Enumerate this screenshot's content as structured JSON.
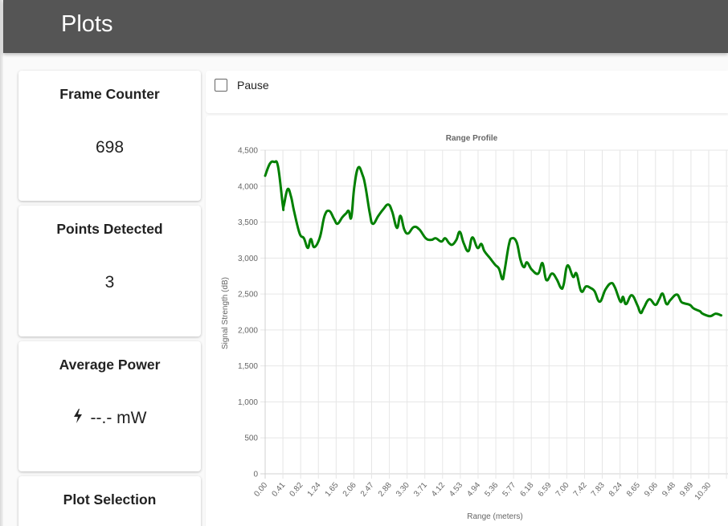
{
  "appbar": {
    "title": "Plots"
  },
  "cards": [
    {
      "title": "Frame Counter",
      "value": "698"
    },
    {
      "title": "Points Detected",
      "value": "3"
    },
    {
      "title": "Average Power",
      "value": "--.- mW",
      "icon": "bolt-icon"
    },
    {
      "title": "Plot Selection"
    }
  ],
  "controls": {
    "pause_label": "Pause",
    "pause_checked": false
  },
  "colors": {
    "appbar": "#555555",
    "line": "#008000",
    "grid": "#e5e5e5"
  },
  "chart_data": {
    "type": "line",
    "title": "Range Profile",
    "xlabel": "Range (meters)",
    "ylabel": "Signal Strength (dB)",
    "ylim": [
      0,
      4500
    ],
    "yticks": [
      0,
      500,
      1000,
      1500,
      2000,
      2500,
      3000,
      3500,
      4000,
      4500
    ],
    "ytick_labels": [
      "0",
      "500",
      "1,000",
      "1,500",
      "2,000",
      "2,500",
      "3,000",
      "3,500",
      "4,000",
      "4,500"
    ],
    "xtick_labels": [
      "0.00",
      "0.41",
      "0.82",
      "1.24",
      "1.65",
      "2.06",
      "2.47",
      "2.88",
      "3.30",
      "3.71",
      "4.12",
      "4.53",
      "4.94",
      "5.36",
      "5.77",
      "6.18",
      "6.59",
      "7.00",
      "7.42",
      "7.83",
      "8.24",
      "8.65",
      "9.06",
      "9.48",
      "9.89",
      "10.30"
    ],
    "grid": true,
    "legend": "none",
    "series": [
      {
        "name": "Range Profile",
        "color": "#008000",
        "x": [
          0.0,
          0.11,
          0.21,
          0.3,
          0.41,
          0.43,
          0.52,
          0.6,
          0.67,
          0.8,
          0.9,
          0.99,
          1.06,
          1.14,
          1.27,
          1.38,
          1.49,
          1.6,
          1.68,
          1.79,
          1.88,
          1.94,
          2.0,
          2.07,
          2.16,
          2.26,
          2.33,
          2.43,
          2.5,
          2.63,
          2.74,
          2.86,
          2.95,
          3.06,
          3.14,
          3.23,
          3.32,
          3.45,
          3.58,
          3.73,
          3.86,
          3.96,
          4.09,
          4.18,
          4.27,
          4.35,
          4.44,
          4.52,
          4.61,
          4.72,
          4.81,
          4.93,
          5.02,
          5.09,
          5.21,
          5.34,
          5.43,
          5.51,
          5.56,
          5.66,
          5.73,
          5.84,
          5.93,
          6.01,
          6.08,
          6.19,
          6.34,
          6.44,
          6.53,
          6.66,
          6.77,
          6.87,
          6.93,
          7.02,
          7.15,
          7.23,
          7.34,
          7.45,
          7.56,
          7.65,
          7.77,
          7.9,
          8.03,
          8.12,
          8.25,
          8.31,
          8.38,
          8.51,
          8.64,
          8.72,
          8.79,
          8.92,
          9.06,
          9.15,
          9.23,
          9.32,
          9.41,
          9.56,
          9.66,
          9.73,
          9.86,
          9.94,
          10.01,
          10.1,
          10.16,
          10.33,
          10.46,
          10.59
        ],
        "values": [
          4145,
          4313,
          4336,
          4269,
          3733,
          3722,
          3956,
          3856,
          3655,
          3342,
          3275,
          3141,
          3264,
          3152,
          3287,
          3588,
          3655,
          3543,
          3476,
          3566,
          3622,
          3655,
          3566,
          3990,
          4258,
          4157,
          3990,
          3622,
          3476,
          3588,
          3677,
          3744,
          3644,
          3420,
          3588,
          3398,
          3342,
          3431,
          3398,
          3275,
          3253,
          3275,
          3230,
          3275,
          3208,
          3186,
          3253,
          3364,
          3208,
          3097,
          3287,
          3141,
          3197,
          3097,
          3007,
          2907,
          2851,
          2706,
          2828,
          3186,
          3275,
          3219,
          2974,
          2873,
          2940,
          2840,
          2784,
          2929,
          2694,
          2784,
          2706,
          2583,
          2628,
          2896,
          2739,
          2784,
          2538,
          2605,
          2583,
          2538,
          2393,
          2560,
          2650,
          2594,
          2393,
          2460,
          2360,
          2483,
          2349,
          2237,
          2304,
          2426,
          2349,
          2426,
          2505,
          2360,
          2416,
          2493,
          2393,
          2371,
          2349,
          2304,
          2282,
          2259,
          2226,
          2192,
          2226,
          2203
        ]
      }
    ]
  }
}
